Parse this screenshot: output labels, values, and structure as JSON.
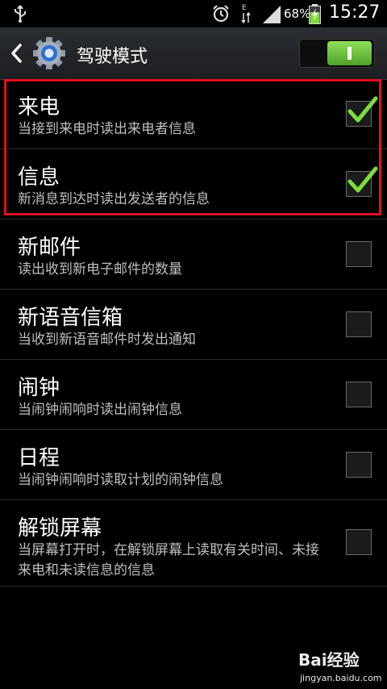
{
  "status_bar": {
    "battery_percent": "68%",
    "time": "15:27",
    "icons": [
      "usb-icon",
      "alarm-icon",
      "data-arrows-icon",
      "signal-icon",
      "battery-charging-icon"
    ]
  },
  "action_bar": {
    "title": "驾驶模式",
    "back_icon": "chevron-left-icon",
    "app_icon": "settings-gear-icon",
    "switch_on": true
  },
  "items": [
    {
      "title": "来电",
      "desc": "当接到来电时读出来电者信息",
      "checked": true
    },
    {
      "title": "信息",
      "desc": "新消息到达时读出发送者的信息",
      "checked": true
    },
    {
      "title": "新邮件",
      "desc": "读出收到新电子邮件的数量",
      "checked": false
    },
    {
      "title": "新语音信箱",
      "desc": "当收到新语音邮件时发出通知",
      "checked": false
    },
    {
      "title": "闹钟",
      "desc": "当闹钟闹响时读出闹钟信息",
      "checked": false
    },
    {
      "title": "日程",
      "desc": "当闹钟闹响时读取计划的闹钟信息",
      "checked": false
    },
    {
      "title": "解锁屏幕",
      "desc": "当屏幕打开时，在解锁屏幕上读取有关时间、未接来电和未读信息的信息",
      "checked": false
    }
  ],
  "colors": {
    "check_green": "#7ddc3e",
    "switch_green": "#5cb82e",
    "highlight_red": "#e0101c"
  },
  "watermark": {
    "brand": "Bai经验",
    "url": "jingyan.baidu.com"
  }
}
